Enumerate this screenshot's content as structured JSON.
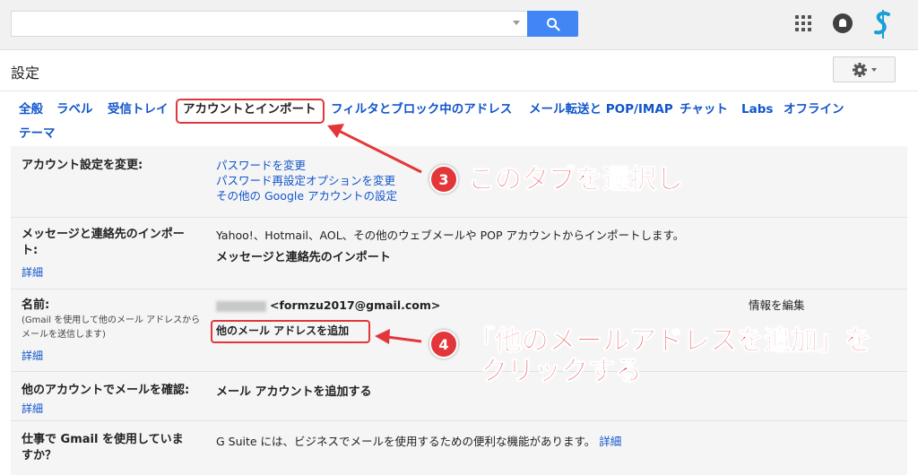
{
  "colors": {
    "accent": "#e3363a",
    "link": "#1155cc",
    "search_blue": "#4285f4"
  },
  "header": {
    "search": {
      "placeholder": ""
    },
    "icons": [
      "search-icon",
      "apps-grid-icon",
      "notifications-icon",
      "account-avatar-icon"
    ]
  },
  "settings": {
    "title": "設定",
    "gear_icon": "gear-icon"
  },
  "tabs": [
    {
      "label": "全般"
    },
    {
      "label": "ラベル"
    },
    {
      "label": "受信トレイ"
    },
    {
      "label": "アカウントとインポート",
      "active": true
    },
    {
      "label": "フィルタとブロック中のアドレス"
    },
    {
      "label": "メール転送と POP/IMAP"
    },
    {
      "label": "チャット"
    },
    {
      "label": "Labs"
    },
    {
      "label": "オフライン"
    },
    {
      "label": "テーマ"
    }
  ],
  "rows": {
    "account": {
      "label": "アカウント設定を変更:",
      "links": [
        "パスワードを変更",
        "パスワード再設定オプションを変更",
        "その他の Google アカウントの設定"
      ]
    },
    "import": {
      "label_line1": "メッセージと連絡先のインポー",
      "label_line2": "ト:",
      "detail": "詳細",
      "description": "Yahoo!、Hotmail、AOL、その他のウェブメールや POP アカウントからインポートします。",
      "action": "メッセージと連絡先のインポート"
    },
    "name": {
      "label": "名前:",
      "sub_line1": "(Gmail を使用して他のメール アドレスから",
      "sub_line2": "メールを送信します)",
      "detail": "詳細",
      "email": "<formzu2017@gmail.com>",
      "edit": "情報を編集",
      "add_address": "他のメール アドレスを追加"
    },
    "check_mail": {
      "label": "他のアカウントでメールを確認:",
      "detail": "詳細",
      "action": "メール アカウントを追加する"
    },
    "work": {
      "label_line1": "仕事で Gmail を使用していま",
      "label_line2": "すか？",
      "description": "G Suite には、ビジネスでメールを使用するための便利な機能があります。",
      "detail": "詳細"
    }
  },
  "callouts": {
    "step3": {
      "number": "3",
      "text": "このタブを選択し"
    },
    "step4": {
      "number": "4",
      "text_line1": "「他のメールアドレスを追加」を",
      "text_line2": "クリックする"
    }
  }
}
